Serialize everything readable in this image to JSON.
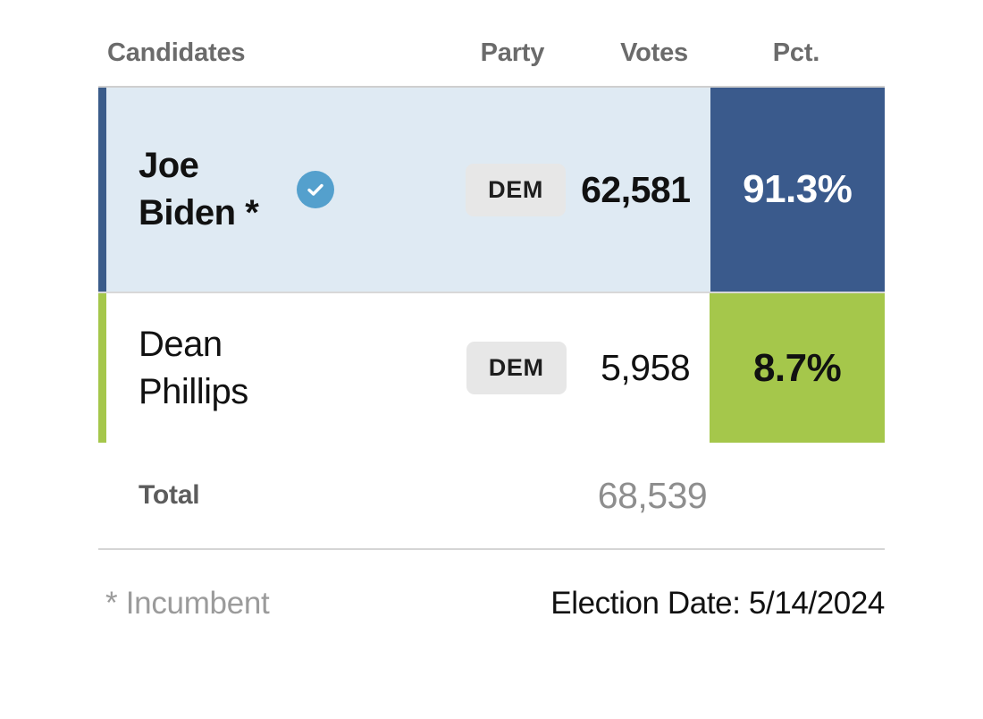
{
  "table": {
    "headers": {
      "candidates": "Candidates",
      "party": "Party",
      "votes": "Votes",
      "pct": "Pct."
    },
    "rows": [
      {
        "name": "Joe Biden *",
        "party": "DEM",
        "votes": "62,581",
        "pct": "91.3%",
        "winner": true,
        "incumbent": true,
        "accent_color": "#3b5c8a",
        "row_background": "#dfeaf3",
        "pct_background": "#3a5a8c",
        "pct_text_color": "#ffffff",
        "check_badge_color": "#54a0cd"
      },
      {
        "name": "Dean Phillips",
        "party": "DEM",
        "votes": "5,958",
        "pct": "8.7%",
        "winner": false,
        "incumbent": false,
        "accent_color": "#a5c74b",
        "row_background": "#ffffff",
        "pct_background": "#a5c74b",
        "pct_text_color": "#111111",
        "check_badge_color": ""
      }
    ],
    "total": {
      "label": "Total",
      "value": "68,539"
    }
  },
  "footer": {
    "incumbent_note": "* Incumbent",
    "election_date": "Election Date: 5/14/2024"
  },
  "chart_data": {
    "type": "table",
    "title": "Election Results",
    "categories": [
      "Joe Biden",
      "Dean Phillips"
    ],
    "series": [
      {
        "name": "Votes",
        "values": [
          62581,
          5958
        ]
      },
      {
        "name": "Pct",
        "values": [
          91.3,
          8.7
        ]
      }
    ],
    "total_votes": 68539,
    "election_date": "5/14/2024"
  }
}
